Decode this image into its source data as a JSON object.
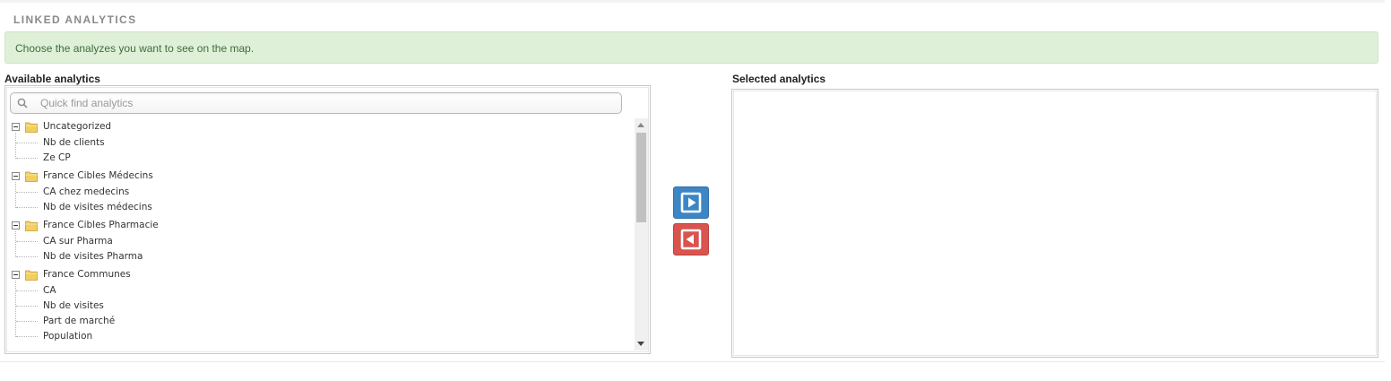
{
  "section": {
    "title": "LINKED ANALYTICS"
  },
  "info": {
    "message": "Choose the analyzes you want to see on the map."
  },
  "available": {
    "label": "Available analytics",
    "search_placeholder": "Quick find analytics",
    "search_value": "",
    "groups": [
      {
        "label": "Uncategorized",
        "items": [
          "Nb de clients",
          "Ze CP"
        ]
      },
      {
        "label": "France Cibles Médecins",
        "items": [
          "CA chez medecins",
          "Nb de visites médecins"
        ]
      },
      {
        "label": "France Cibles Pharmacie",
        "items": [
          "CA sur Pharma",
          "Nb de visites Pharma"
        ]
      },
      {
        "label": "France Communes",
        "items": [
          "CA",
          "Nb de visites",
          "Part de marché",
          "Population"
        ]
      }
    ]
  },
  "transfer": {
    "add_icon": "arrow-right-icon",
    "remove_icon": "arrow-left-icon"
  },
  "selected": {
    "label": "Selected analytics",
    "items": []
  },
  "colors": {
    "info_bg": "#dff0d8",
    "add_button": "#3d86c6",
    "remove_button": "#d9534f"
  }
}
